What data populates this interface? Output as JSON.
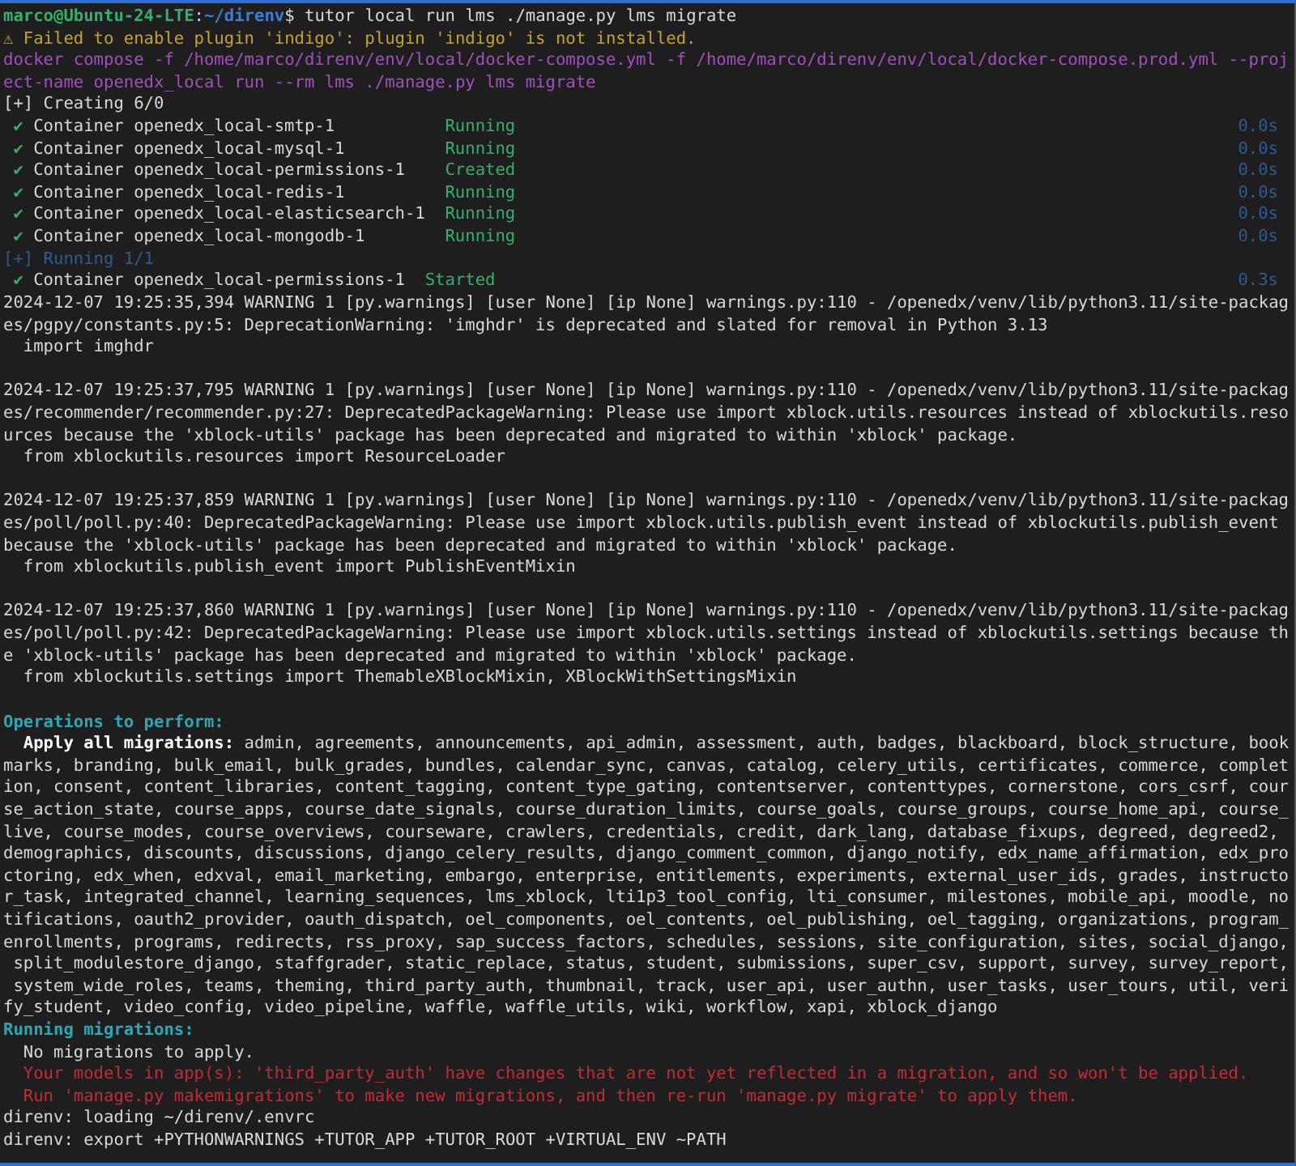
{
  "terminal": {
    "lines": [
      {
        "kind": "prompt",
        "spans": [
          {
            "text": "marco@Ubuntu-24-LTE",
            "kind": "user"
          },
          {
            "text": ":",
            "kind": "plain"
          },
          {
            "text": "~/direnv",
            "kind": "path"
          },
          {
            "text": "$ tutor local run lms ./manage.py lms migrate",
            "kind": "plain"
          }
        ]
      },
      {
        "kind": "output",
        "spans": [
          {
            "text": "⚠ Failed to enable plugin 'indigo': plugin 'indigo' is not installed.",
            "kind": "warn"
          }
        ]
      },
      {
        "kind": "output",
        "spans": [
          {
            "text": "docker compose -f /home/marco/direnv/env/local/docker-compose.yml -f /home/marco/direnv/env/local/docker-compose.prod.yml --proj",
            "kind": "echo"
          }
        ]
      },
      {
        "kind": "output",
        "spans": [
          {
            "text": "ect-name openedx_local run --rm lms ./manage.py lms migrate",
            "kind": "echo"
          }
        ]
      },
      {
        "kind": "output",
        "spans": [
          {
            "text": "[+] Creating 6/0",
            "kind": "plain"
          }
        ]
      },
      {
        "kind": "container",
        "align": true,
        "check": "✔",
        "name": "Container openedx_local-smtp-1",
        "status": "Running",
        "time": "0.0s"
      },
      {
        "kind": "container",
        "align": true,
        "check": "✔",
        "name": "Container openedx_local-mysql-1",
        "status": "Running",
        "time": "0.0s"
      },
      {
        "kind": "container",
        "align": true,
        "check": "✔",
        "name": "Container openedx_local-permissions-1",
        "status": "Created",
        "time": "0.0s"
      },
      {
        "kind": "container",
        "align": true,
        "check": "✔",
        "name": "Container openedx_local-redis-1",
        "status": "Running",
        "time": "0.0s"
      },
      {
        "kind": "container",
        "align": true,
        "check": "✔",
        "name": "Container openedx_local-elasticsearch-1",
        "status": "Running",
        "time": "0.0s"
      },
      {
        "kind": "container",
        "align": true,
        "check": "✔",
        "name": "Container openedx_local-mongodb-1",
        "status": "Running",
        "time": "0.0s"
      },
      {
        "kind": "output",
        "spans": [
          {
            "text": "[+] Running 1/1",
            "kind": "dim"
          }
        ]
      },
      {
        "kind": "container",
        "align": false,
        "check": "✔",
        "name": "Container openedx_local-permissions-1",
        "status": "Started",
        "time": "0.3s"
      },
      {
        "kind": "output",
        "spans": [
          {
            "text": "2024-12-07 19:25:35,394 WARNING 1 [py.warnings] [user None] [ip None] warnings.py:110 - /openedx/venv/lib/python3.11/site-packag",
            "kind": "plain"
          }
        ]
      },
      {
        "kind": "output",
        "spans": [
          {
            "text": "es/pgpy/constants.py:5: DeprecationWarning: 'imghdr' is deprecated and slated for removal in Python 3.13",
            "kind": "plain"
          }
        ]
      },
      {
        "kind": "output",
        "spans": [
          {
            "text": "  import imghdr",
            "kind": "plain"
          }
        ]
      },
      {
        "kind": "blank"
      },
      {
        "kind": "output",
        "spans": [
          {
            "text": "2024-12-07 19:25:37,795 WARNING 1 [py.warnings] [user None] [ip None] warnings.py:110 - /openedx/venv/lib/python3.11/site-packag",
            "kind": "plain"
          }
        ]
      },
      {
        "kind": "output",
        "spans": [
          {
            "text": "es/recommender/recommender.py:27: DeprecatedPackageWarning: Please use import xblock.utils.resources instead of xblockutils.reso",
            "kind": "plain"
          }
        ]
      },
      {
        "kind": "output",
        "spans": [
          {
            "text": "urces because the 'xblock-utils' package has been deprecated and migrated to within 'xblock' package.",
            "kind": "plain"
          }
        ]
      },
      {
        "kind": "output",
        "spans": [
          {
            "text": "  from xblockutils.resources import ResourceLoader",
            "kind": "plain"
          }
        ]
      },
      {
        "kind": "blank"
      },
      {
        "kind": "output",
        "spans": [
          {
            "text": "2024-12-07 19:25:37,859 WARNING 1 [py.warnings] [user None] [ip None] warnings.py:110 - /openedx/venv/lib/python3.11/site-packag",
            "kind": "plain"
          }
        ]
      },
      {
        "kind": "output",
        "spans": [
          {
            "text": "es/poll/poll.py:40: DeprecatedPackageWarning: Please use import xblock.utils.publish_event instead of xblockutils.publish_event",
            "kind": "plain"
          }
        ]
      },
      {
        "kind": "output",
        "spans": [
          {
            "text": "because the 'xblock-utils' package has been deprecated and migrated to within 'xblock' package.",
            "kind": "plain"
          }
        ]
      },
      {
        "kind": "output",
        "spans": [
          {
            "text": "  from xblockutils.publish_event import PublishEventMixin",
            "kind": "plain"
          }
        ]
      },
      {
        "kind": "blank"
      },
      {
        "kind": "output",
        "spans": [
          {
            "text": "2024-12-07 19:25:37,860 WARNING 1 [py.warnings] [user None] [ip None] warnings.py:110 - /openedx/venv/lib/python3.11/site-packag",
            "kind": "plain"
          }
        ]
      },
      {
        "kind": "output",
        "spans": [
          {
            "text": "es/poll/poll.py:42: DeprecatedPackageWarning: Please use import xblock.utils.settings instead of xblockutils.settings because th",
            "kind": "plain"
          }
        ]
      },
      {
        "kind": "output",
        "spans": [
          {
            "text": "e 'xblock-utils' package has been deprecated and migrated to within 'xblock' package.",
            "kind": "plain"
          }
        ]
      },
      {
        "kind": "output",
        "spans": [
          {
            "text": "  from xblockutils.settings import ThemableXBlockMixin, XBlockWithSettingsMixin",
            "kind": "plain"
          }
        ]
      },
      {
        "kind": "blank"
      },
      {
        "kind": "output",
        "spans": [
          {
            "text": "Operations to perform:",
            "kind": "heading"
          }
        ]
      },
      {
        "kind": "output",
        "spans": [
          {
            "text": "  Apply all migrations:",
            "kind": "bold"
          },
          {
            "text": " admin, agreements, announcements, api_admin, assessment, auth, badges, blackboard, block_structure, book",
            "kind": "plain"
          }
        ]
      },
      {
        "kind": "output",
        "spans": [
          {
            "text": "marks, branding, bulk_email, bulk_grades, bundles, calendar_sync, canvas, catalog, celery_utils, certificates, commerce, complet",
            "kind": "plain"
          }
        ]
      },
      {
        "kind": "output",
        "spans": [
          {
            "text": "ion, consent, content_libraries, content_tagging, content_type_gating, contentserver, contenttypes, cornerstone, cors_csrf, cour",
            "kind": "plain"
          }
        ]
      },
      {
        "kind": "output",
        "spans": [
          {
            "text": "se_action_state, course_apps, course_date_signals, course_duration_limits, course_goals, course_groups, course_home_api, course_",
            "kind": "plain"
          }
        ]
      },
      {
        "kind": "output",
        "spans": [
          {
            "text": "live, course_modes, course_overviews, courseware, crawlers, credentials, credit, dark_lang, database_fixups, degreed, degreed2,",
            "kind": "plain"
          }
        ]
      },
      {
        "kind": "output",
        "spans": [
          {
            "text": "demographics, discounts, discussions, django_celery_results, django_comment_common, django_notify, edx_name_affirmation, edx_pro",
            "kind": "plain"
          }
        ]
      },
      {
        "kind": "output",
        "spans": [
          {
            "text": "ctoring, edx_when, edxval, email_marketing, embargo, enterprise, entitlements, experiments, external_user_ids, grades, instructo",
            "kind": "plain"
          }
        ]
      },
      {
        "kind": "output",
        "spans": [
          {
            "text": "r_task, integrated_channel, learning_sequences, lms_xblock, lti1p3_tool_config, lti_consumer, milestones, mobile_api, moodle, no",
            "kind": "plain"
          }
        ]
      },
      {
        "kind": "output",
        "spans": [
          {
            "text": "tifications, oauth2_provider, oauth_dispatch, oel_components, oel_contents, oel_publishing, oel_tagging, organizations, program_",
            "kind": "plain"
          }
        ]
      },
      {
        "kind": "output",
        "spans": [
          {
            "text": "enrollments, programs, redirects, rss_proxy, sap_success_factors, schedules, sessions, site_configuration, sites, social_django,",
            "kind": "plain"
          }
        ]
      },
      {
        "kind": "output",
        "spans": [
          {
            "text": " split_modulestore_django, staffgrader, static_replace, status, student, submissions, super_csv, support, survey, survey_report,",
            "kind": "plain"
          }
        ]
      },
      {
        "kind": "output",
        "spans": [
          {
            "text": " system_wide_roles, teams, theming, third_party_auth, thumbnail, track, user_api, user_authn, user_tasks, user_tours, util, veri",
            "kind": "plain"
          }
        ]
      },
      {
        "kind": "output",
        "spans": [
          {
            "text": "fy_student, video_config, video_pipeline, waffle, waffle_utils, wiki, workflow, xapi, xblock_django",
            "kind": "plain"
          }
        ]
      },
      {
        "kind": "output",
        "spans": [
          {
            "text": "Running migrations:",
            "kind": "heading"
          }
        ]
      },
      {
        "kind": "output",
        "spans": [
          {
            "text": "  No migrations to apply.",
            "kind": "plain"
          }
        ]
      },
      {
        "kind": "output",
        "spans": [
          {
            "text": "  Your models in app(s): 'third_party_auth' have changes that are not yet reflected in a migration, and so won't be applied.",
            "kind": "error"
          }
        ]
      },
      {
        "kind": "output",
        "spans": [
          {
            "text": "  Run 'manage.py makemigrations' to make new migrations, and then re-run 'manage.py migrate' to apply them.",
            "kind": "error"
          }
        ]
      },
      {
        "kind": "output",
        "spans": [
          {
            "text": "direnv: loading ~/direnv/.envrc",
            "kind": "plain"
          }
        ]
      },
      {
        "kind": "output",
        "spans": [
          {
            "text": "direnv: export +PYTHONWARNINGS +TUTOR_APP +TUTOR_ROOT +VIRTUAL_ENV ~PATH",
            "kind": "plain"
          }
        ]
      }
    ]
  }
}
